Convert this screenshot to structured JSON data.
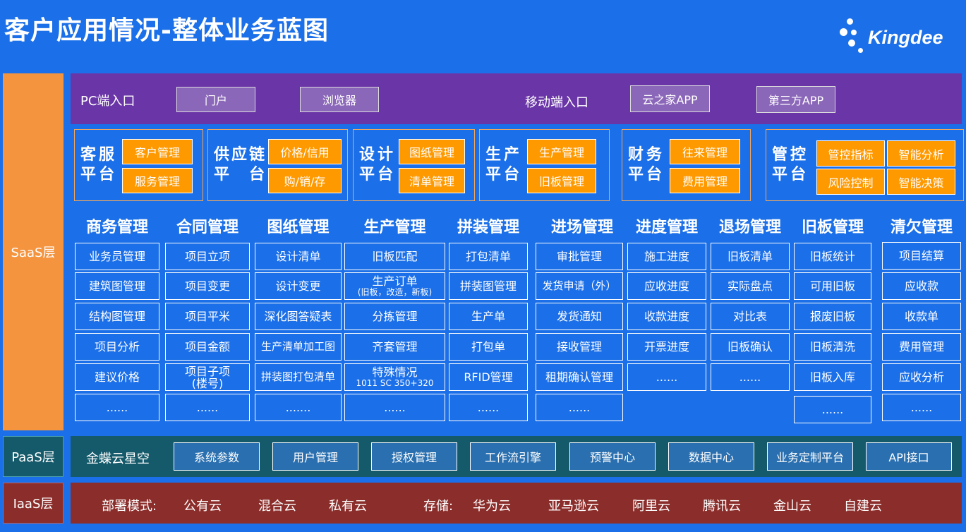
{
  "title": "客户应用情况-整体业务蓝图",
  "logo": {
    "text": "Kingdee"
  },
  "layers": {
    "saas": "SaaS层",
    "paas": "PaaS层",
    "iaas": "IaaS层"
  },
  "entry": {
    "pc_label": "PC端入口",
    "pc_buttons": [
      "门户",
      "浏览器"
    ],
    "mobile_label": "移动端入口",
    "mobile_buttons": [
      "云之家APP",
      "第三方APP"
    ]
  },
  "platforms": [
    {
      "name": "客服平台",
      "line1": "客服",
      "line2": "平台",
      "items": [
        "客户管理",
        "服务管理"
      ]
    },
    {
      "name": "供应链平台",
      "line1": "供应链",
      "line2": "平台",
      "items": [
        "价格/信用",
        "购/销/存"
      ]
    },
    {
      "name": "设计平台",
      "line1": "设计",
      "line2": "平台",
      "items": [
        "图纸管理",
        "清单管理"
      ]
    },
    {
      "name": "生产平台",
      "line1": "生产",
      "line2": "平台",
      "items": [
        "生产管理",
        "旧板管理"
      ]
    },
    {
      "name": "财务平台",
      "line1": "财务",
      "line2": "平台",
      "items": [
        "往来管理",
        "费用管理"
      ]
    },
    {
      "name": "管控平台",
      "line1": "管控",
      "line2": "平台",
      "items": [
        "管控指标",
        "智能分析",
        "风险控制",
        "智能决策"
      ]
    }
  ],
  "columns": [
    {
      "header": "商务管理",
      "cells": [
        "业务员管理",
        "建筑图管理",
        "结构图管理",
        "项目分析",
        "建议价格",
        "......"
      ]
    },
    {
      "header": "合同管理",
      "cells": [
        "项目立项",
        "项目变更",
        "项目平米",
        "项目金额",
        "项目子项\n(楼号)",
        "......"
      ]
    },
    {
      "header": "图纸管理",
      "cells": [
        "设计清单",
        "设计变更",
        "深化图答疑表",
        "生产清单加工图",
        "拼装图打包清单",
        "......."
      ]
    },
    {
      "header": "生产管理",
      "cells": [
        "旧板匹配",
        "生产订单",
        "分拣管理",
        "齐套管理",
        "特殊情况",
        "......"
      ],
      "subs": [
        "",
        "(旧板，改造，新板)",
        "",
        "",
        "1011 SC 350+320",
        ""
      ]
    },
    {
      "header": "拼装管理",
      "cells": [
        "打包清单",
        "拼装图管理",
        "生产单",
        "打包单",
        "RFID管理",
        "......"
      ]
    },
    {
      "header": "进场管理",
      "cells": [
        "审批管理",
        "发货申请（外）",
        "发货通知",
        "接收管理",
        "租期确认管理",
        "......"
      ]
    },
    {
      "header": "进度管理",
      "cells": [
        "施工进度",
        "应收进度",
        "收款进度",
        "开票进度",
        "......"
      ]
    },
    {
      "header": "退场管理",
      "cells": [
        "旧板清单",
        "实际盘点",
        "对比表",
        "旧板确认",
        "......"
      ]
    },
    {
      "header": "旧板管理",
      "cells": [
        "旧板统计",
        "可用旧板",
        "报废旧板",
        "旧板清洗",
        "旧板入库",
        "......"
      ]
    },
    {
      "header": "清欠管理",
      "cells": [
        "项目结算",
        "应收款",
        "收款单",
        "费用管理",
        "应收分析",
        "......"
      ]
    }
  ],
  "paas": {
    "name": "金蝶云星空",
    "items": [
      "系统参数",
      "用户管理",
      "授权管理",
      "工作流引擎",
      "预警中心",
      "数据中心",
      "业务定制平台",
      "API接口"
    ]
  },
  "iaas": {
    "deploy_label": "部署模式:",
    "deploy_items": [
      "公有云",
      "混合云",
      "私有云"
    ],
    "storage_label": "存储:",
    "storage_items": [
      "华为云",
      "亚马逊云",
      "阿里云",
      "腾讯云",
      "金山云",
      "自建云"
    ]
  }
}
